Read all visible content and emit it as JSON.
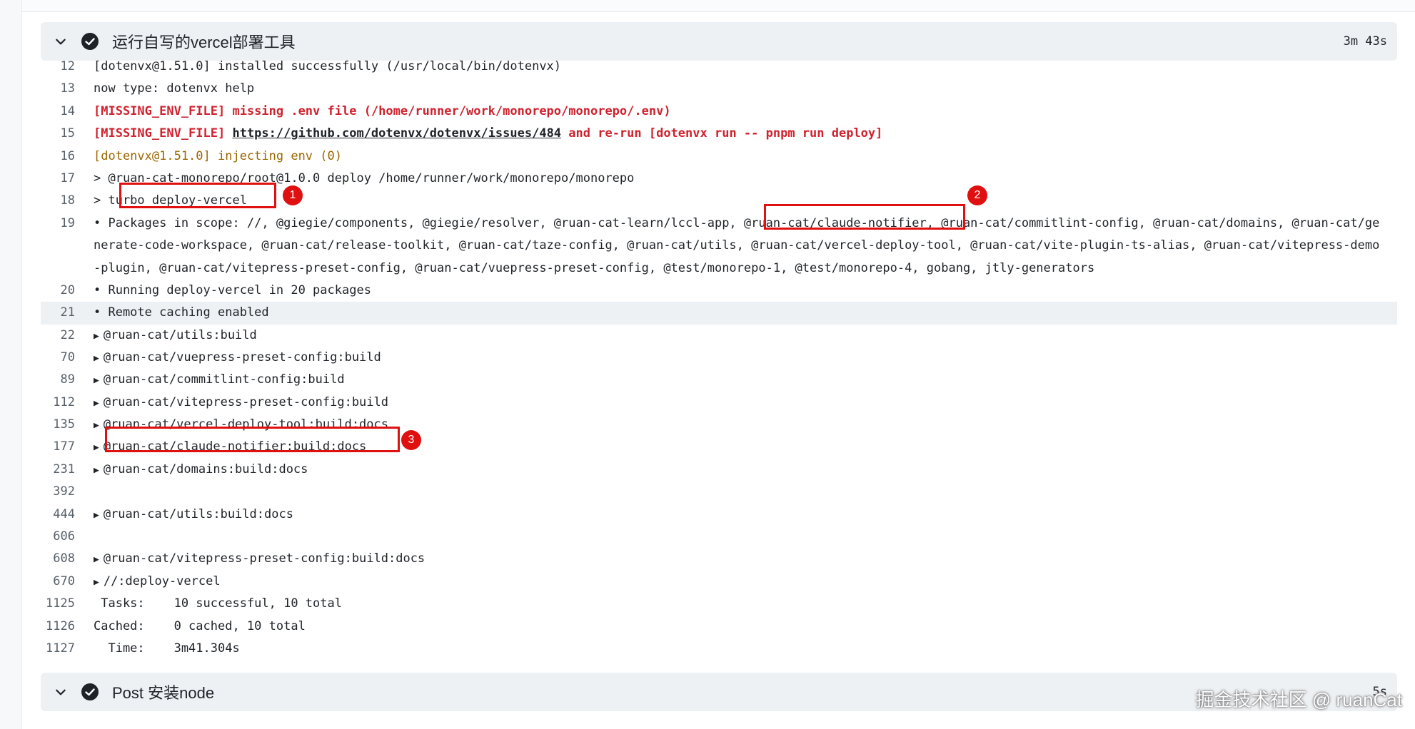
{
  "steps": [
    {
      "title": "运行自写的vercel部署工具",
      "duration": "3m 43s"
    },
    {
      "title": "Post 安装node",
      "duration": "5s"
    }
  ],
  "log": {
    "lines": [
      {
        "n": "12",
        "t": "[dotenvx@1.51.0] installed successfully (/usr/local/bin/dotenvx)"
      },
      {
        "n": "13",
        "t": "now type: dotenvx help"
      },
      {
        "n": "14",
        "t": "[MISSING_ENV_FILE] missing .env file (/home/runner/work/monorepo/monorepo/.env)"
      },
      {
        "n": "15",
        "a": "[MISSING_ENV_FILE] ",
        "b": "https://github.com/dotenvx/dotenvx/issues/484",
        "c": " and re-run [dotenvx run -- pnpm run deploy]"
      },
      {
        "n": "16",
        "t": "[dotenvx@1.51.0] injecting env (0)"
      },
      {
        "n": "17",
        "t": "> @ruan-cat-monorepo/root@1.0.0 deploy /home/runner/work/monorepo/monorepo"
      },
      {
        "n": "18",
        "t": "> turbo deploy-vercel"
      },
      {
        "n": "19",
        "t": "• Packages in scope: //, @giegie/components, @giegie/resolver, @ruan-cat-learn/lccl-app, @ruan-cat/claude-notifier, @ruan-cat/commitlint-config, @ruan-cat/domains, @ruan-cat/generate-code-workspace, @ruan-cat/release-toolkit, @ruan-cat/taze-config, @ruan-cat/utils, @ruan-cat/vercel-deploy-tool, @ruan-cat/vite-plugin-ts-alias, @ruan-cat/vitepress-demo-plugin, @ruan-cat/vitepress-preset-config, @ruan-cat/vuepress-preset-config, @test/monorepo-1, @test/monorepo-4, gobang, jtly-generators"
      },
      {
        "n": "20",
        "t": "• Running deploy-vercel in 20 packages"
      },
      {
        "n": "21",
        "t": "• Remote caching enabled"
      },
      {
        "n": "22",
        "t": "@ruan-cat/utils:build"
      },
      {
        "n": "70",
        "t": "@ruan-cat/vuepress-preset-config:build"
      },
      {
        "n": "89",
        "t": "@ruan-cat/commitlint-config:build"
      },
      {
        "n": "112",
        "t": "@ruan-cat/vitepress-preset-config:build"
      },
      {
        "n": "135",
        "t": "@ruan-cat/vercel-deploy-tool:build:docs"
      },
      {
        "n": "177",
        "t": "@ruan-cat/claude-notifier:build:docs"
      },
      {
        "n": "231",
        "t": "@ruan-cat/domains:build:docs"
      },
      {
        "n": "392",
        "t": ""
      },
      {
        "n": "444",
        "t": "@ruan-cat/utils:build:docs"
      },
      {
        "n": "606",
        "t": ""
      },
      {
        "n": "608",
        "t": "@ruan-cat/vitepress-preset-config:build:docs"
      },
      {
        "n": "670",
        "t": "//:deploy-vercel"
      },
      {
        "n": "1125",
        "t": " Tasks:    10 successful, 10 total"
      },
      {
        "n": "1126",
        "t": "Cached:    0 cached, 10 total"
      },
      {
        "n": "1127",
        "t": "  Time:    3m41.304s"
      }
    ]
  },
  "annotations": [
    "1",
    "2",
    "3"
  ],
  "watermark": "掘金技术社区 @ ruanCat",
  "colors": {
    "error": "#cf222e",
    "info": "#9a6700",
    "annotation": "#e01010",
    "header_bg": "#eef1f4"
  },
  "icons": {
    "collapse": "chevron-down-icon",
    "status": "check-circle-icon",
    "group": "triangle-right-icon"
  }
}
